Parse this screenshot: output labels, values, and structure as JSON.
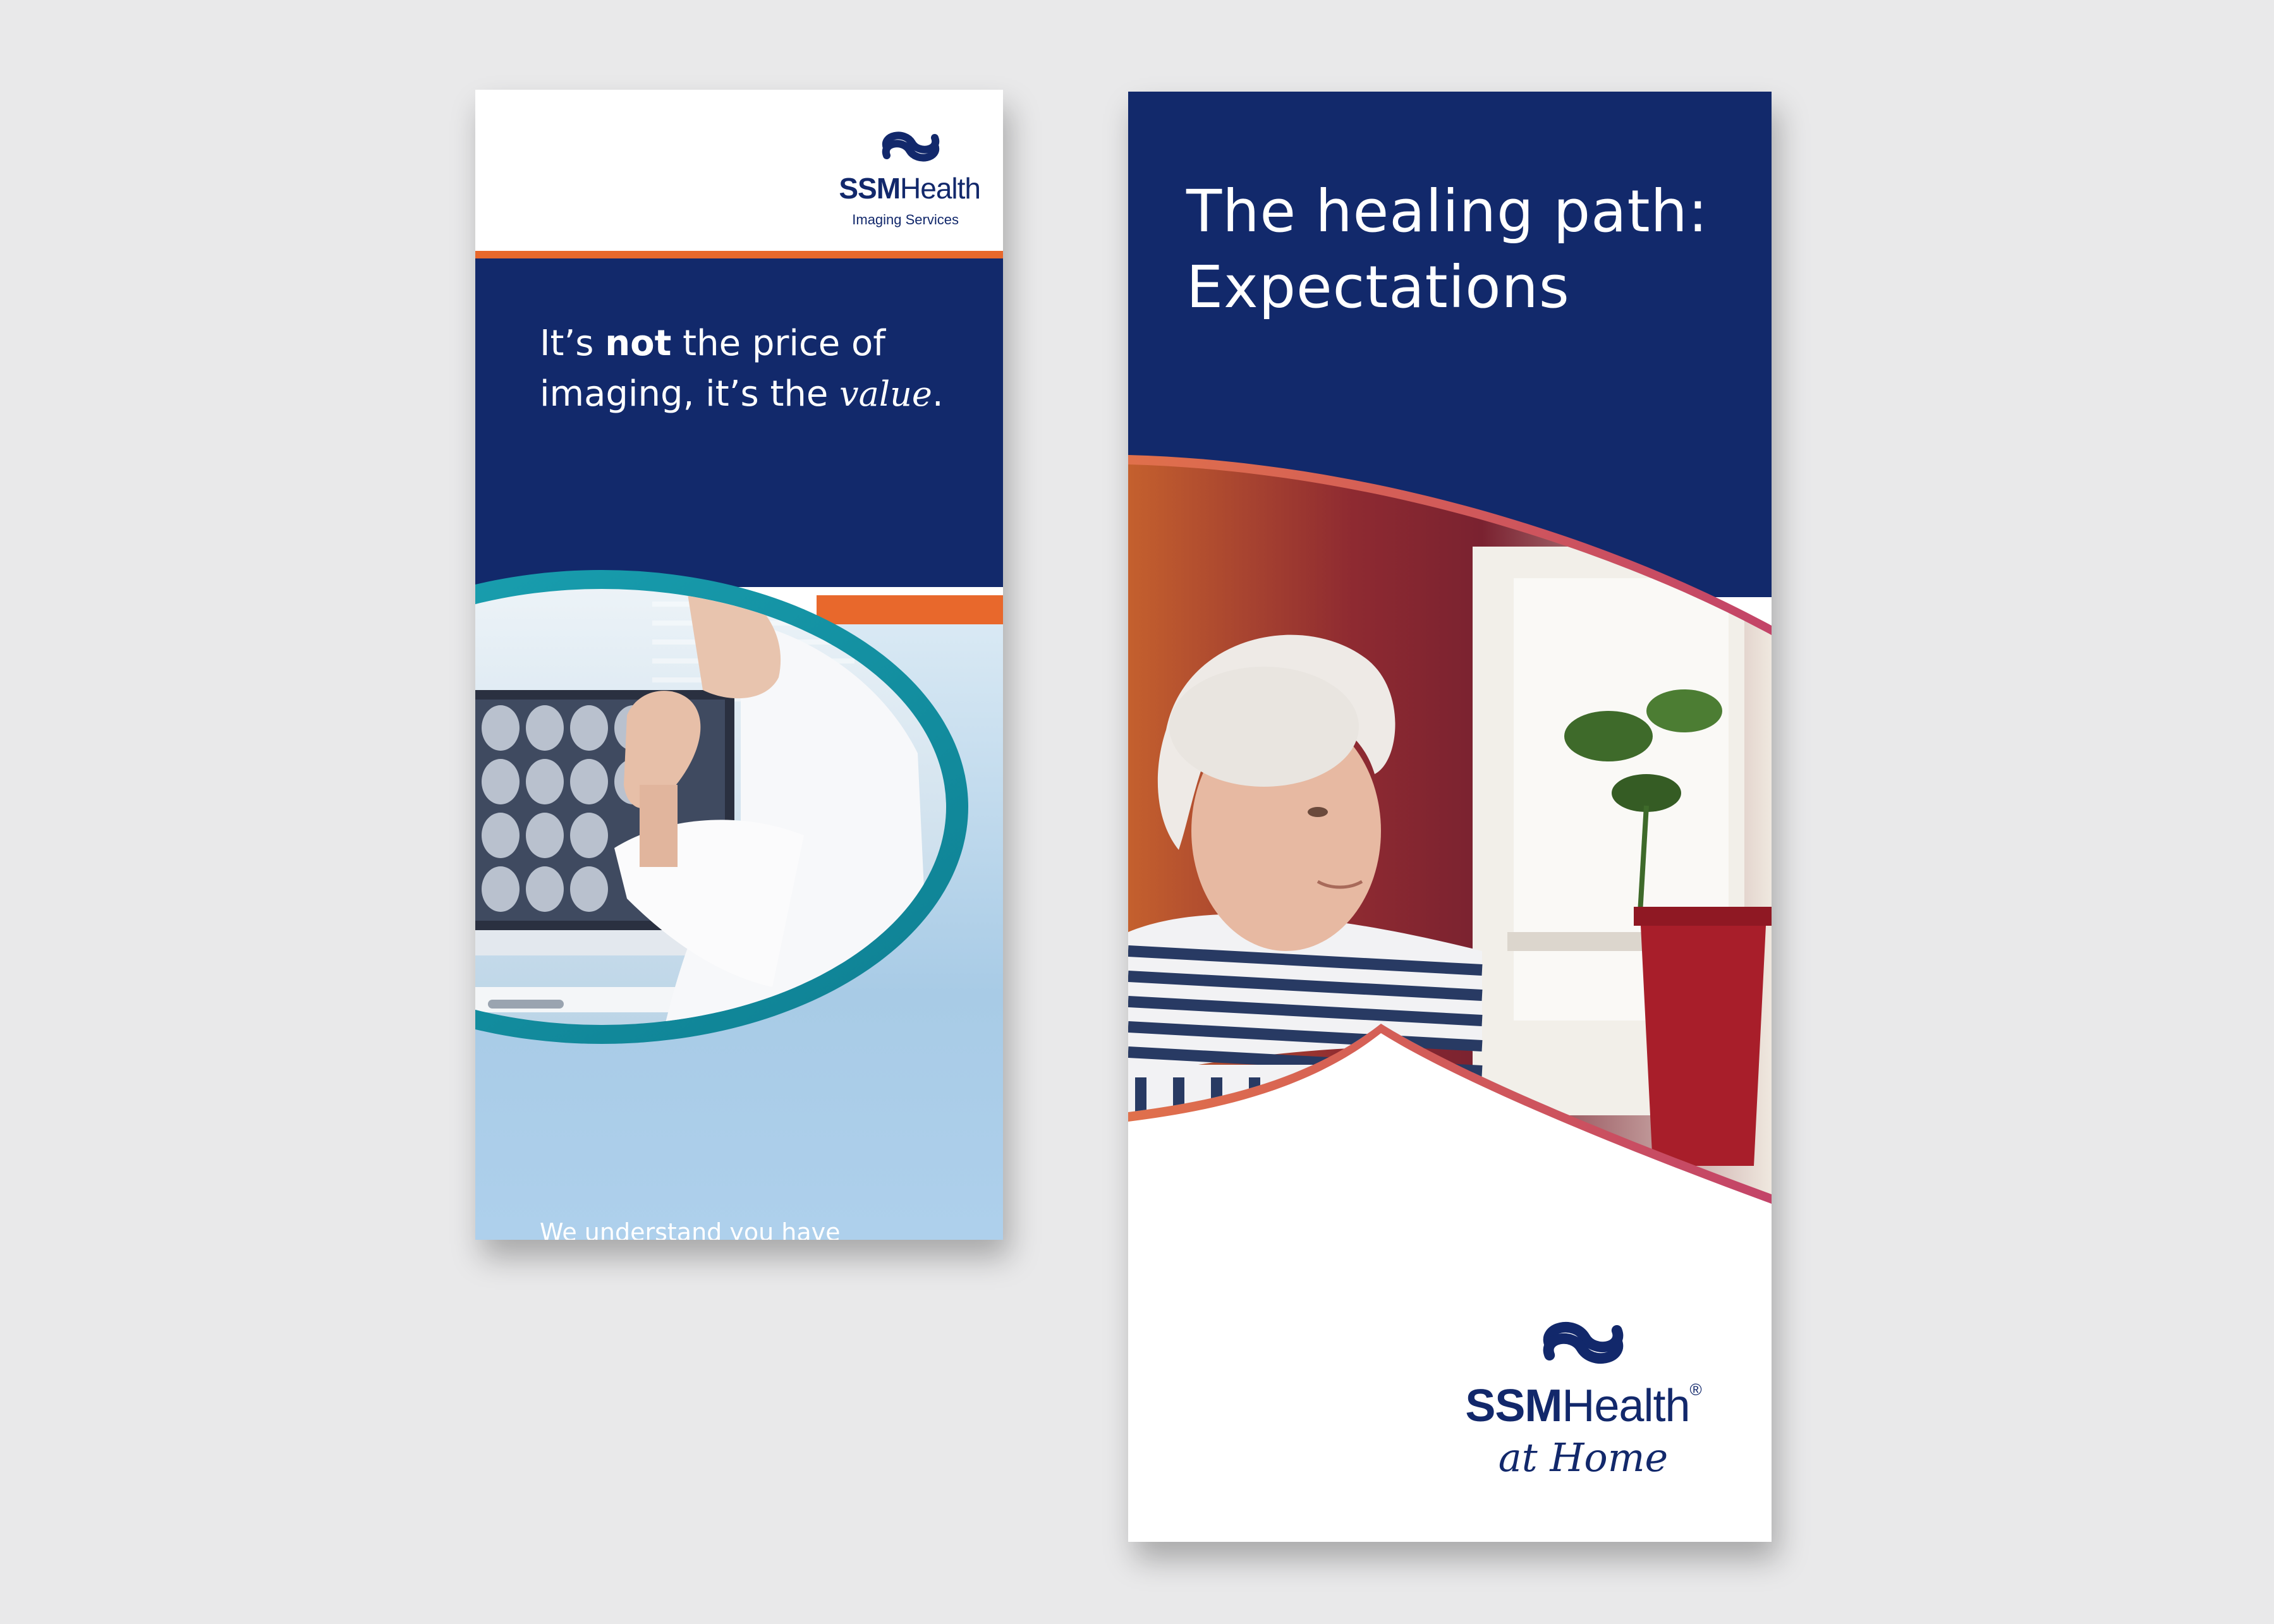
{
  "brochure_imaging": {
    "logo": {
      "brand_bold": "SSM",
      "brand_regular": "Health",
      "subtitle": "Imaging Services"
    },
    "headline": {
      "pre_bold": "It’s ",
      "bold": "not",
      "post_bold": " the price of",
      "line2_pre": "imaging, it’s the ",
      "italic": "value",
      "end": "."
    },
    "tagline": "We understand you have\na choice in imaging centers."
  },
  "brochure_home": {
    "title_line1": "The healing path:",
    "title_line2": "Expectations",
    "logo": {
      "brand_bold": "SSM",
      "brand_regular": "Health",
      "registered": "®",
      "subtitle": "at Home"
    }
  },
  "colors": {
    "navy": "#12296b",
    "orange": "#e8682c",
    "teal": "#1493a4",
    "coral_gradient_start": "#e0704b",
    "coral_gradient_end": "#c34468"
  }
}
